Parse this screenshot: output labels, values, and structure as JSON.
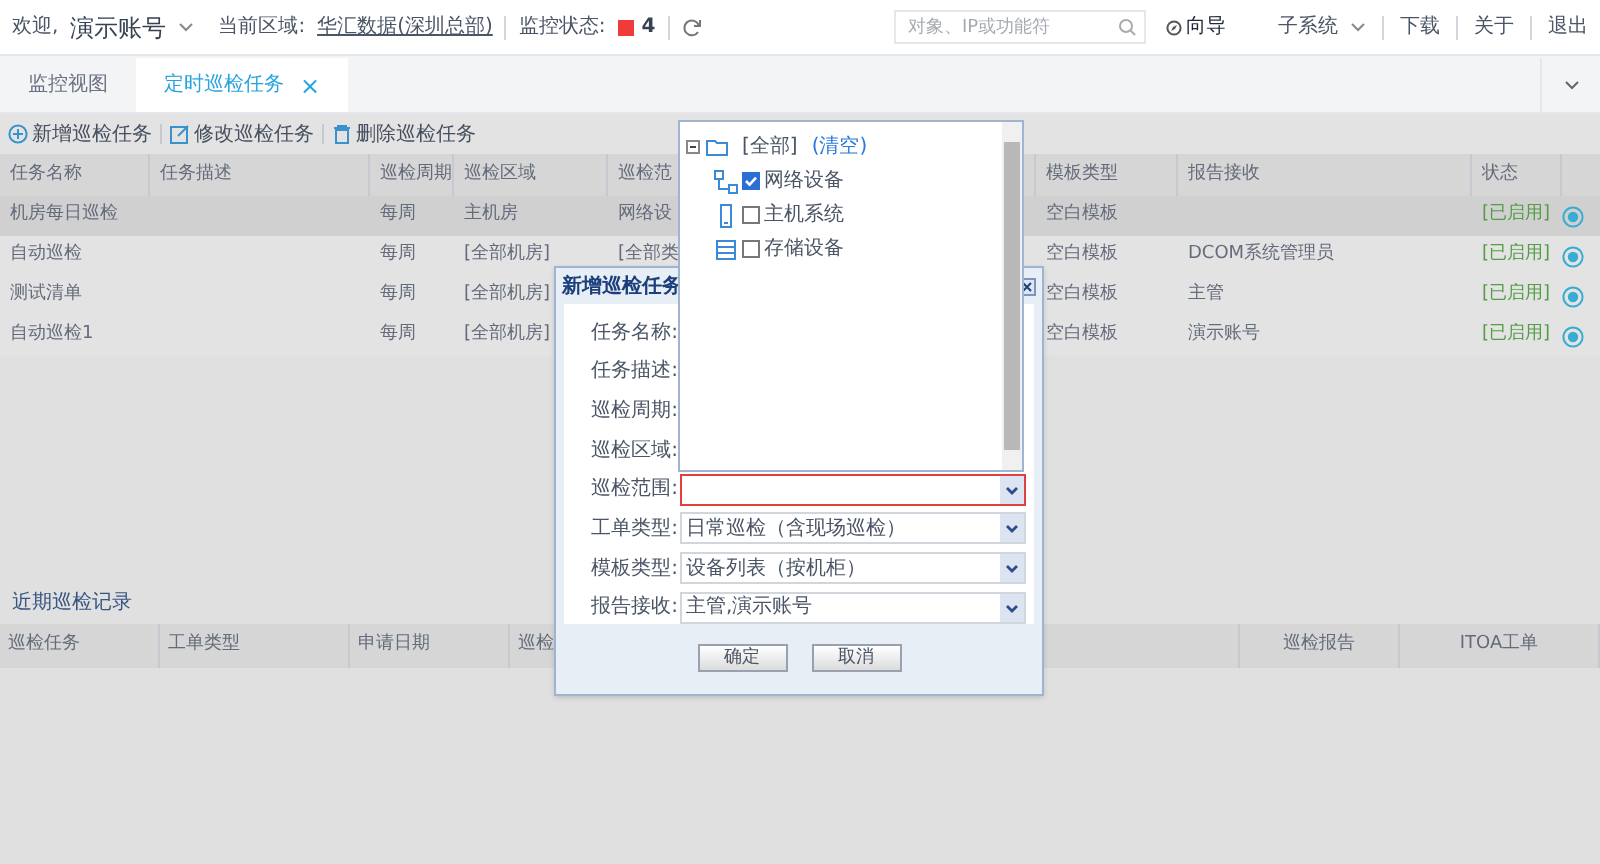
{
  "top_bar": {
    "welcome": "欢迎,",
    "user": "演示账号",
    "area_label": "当前区域:",
    "area": "华汇数据(深圳总部)",
    "monitor_label": "监控状态:",
    "alarm_count": "4",
    "search": {
      "placeholder": "对象、IP或功能符"
    },
    "links": [
      {
        "label": "向导",
        "kind": "guide"
      },
      {
        "label": "子系统",
        "kind": "menu"
      },
      {
        "label": "下载",
        "kind": "plain"
      },
      {
        "label": "关于",
        "kind": "plain"
      },
      {
        "label": "退出",
        "kind": "plain"
      }
    ]
  },
  "tabs": [
    {
      "label": "监控视图",
      "selected": false
    },
    {
      "label": "定时巡检任务",
      "selected": true,
      "close": "×"
    }
  ],
  "toolbar": [
    {
      "label": "新增巡检任务",
      "kind": "add"
    },
    {
      "label": "修改巡检任务",
      "kind": "edit"
    },
    {
      "label": "删除巡检任务",
      "kind": "delete"
    }
  ],
  "task_table": {
    "columns": [
      "任务名称",
      "任务描述",
      "巡检周期",
      "巡检区域",
      "巡检范",
      "模板类型",
      "报告接收",
      "状态"
    ],
    "rows": [
      {
        "selected": true,
        "name": "机房每日巡检",
        "period": "每周",
        "area": "主机房",
        "range": "网络设",
        "template": "空白模板",
        "status": "[已启用]"
      },
      {
        "selected": false,
        "name": "自动巡检",
        "period": "每周",
        "area": "[全部机房]",
        "range": "[全部类",
        "template": "空白模板",
        "receiver": "DCOM系统管理员",
        "status": "[已启用]"
      },
      {
        "selected": false,
        "name": "测试清单",
        "period": "每周",
        "area": "[全部机房]",
        "template": "空白模板",
        "receiver": "主管",
        "status": "[已启用]"
      },
      {
        "selected": false,
        "name": "自动巡检1",
        "period": "每周",
        "area": "[全部机房]",
        "template": "空白模板",
        "receiver": "演示账号",
        "status": "[已启用]"
      }
    ]
  },
  "recent": {
    "title": "近期巡检记录",
    "columns": [
      "巡检任务",
      "工单类型",
      "申请日期",
      "巡检",
      "巡检报告",
      "ITOA工单"
    ]
  },
  "dialog": {
    "title": "新增巡检任务",
    "fields": [
      {
        "label": "任务名称:",
        "kind": "text"
      },
      {
        "label": "任务描述:",
        "kind": "text"
      },
      {
        "label": "巡检周期:",
        "kind": "text"
      },
      {
        "label": "巡检区域:",
        "kind": "text"
      },
      {
        "label": "巡检范围:",
        "kind": "select",
        "invalid": true
      },
      {
        "label": "工单类型:",
        "kind": "select",
        "invalid": false,
        "value": "日常巡检（含现场巡检）"
      },
      {
        "label": "模板类型:",
        "kind": "select",
        "invalid": false,
        "value": "设备列表（按机柜）"
      },
      {
        "label": "报告接收:",
        "kind": "select",
        "invalid": false,
        "value": "主管,演示账号"
      }
    ],
    "buttons": [
      "确定",
      "取消"
    ]
  },
  "tree": {
    "label": "[全部]",
    "action": "(清空)",
    "expanded": true,
    "children": [
      {
        "label": "网络设备",
        "kind": "network",
        "checked": true
      },
      {
        "label": "主机系统",
        "kind": "host",
        "checked": false
      },
      {
        "label": "存储设备",
        "kind": "storage",
        "checked": false
      }
    ]
  }
}
